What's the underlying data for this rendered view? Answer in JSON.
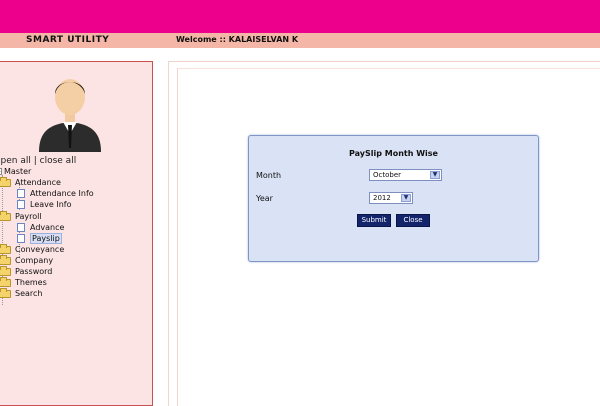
{
  "header": {
    "app_title": "SMART UTILITY",
    "welcome": "Welcome :: KALAISELVAN K"
  },
  "sidebar": {
    "open_all": "open all",
    "separator": "|",
    "close_all": "close all",
    "root": "Master",
    "attendance": "Attendance",
    "attendance_info": "Attendance Info",
    "leave_info": "Leave Info",
    "payroll": "Payroll",
    "advance": "Advance",
    "payslip": "Payslip",
    "conveyance": "Conveyance",
    "company": "Company",
    "password": "Password",
    "themes": "Themes",
    "search": "Search"
  },
  "panel": {
    "title": "PaySlip Month Wise",
    "month_label": "Month",
    "month_value": "October",
    "year_label": "Year",
    "year_value": "2012",
    "submit": "Submit",
    "close": "Close"
  },
  "icons": {
    "dropdown": "chevron-down-icon",
    "folder": "folder-icon",
    "document": "document-icon"
  },
  "colors": {
    "header_bg": "#ec008c",
    "subbar_bg": "#f4b6a6",
    "sidebar_bg": "#fde4e4",
    "panel_bg": "#dae3f6",
    "button_bg": "#13246b"
  }
}
